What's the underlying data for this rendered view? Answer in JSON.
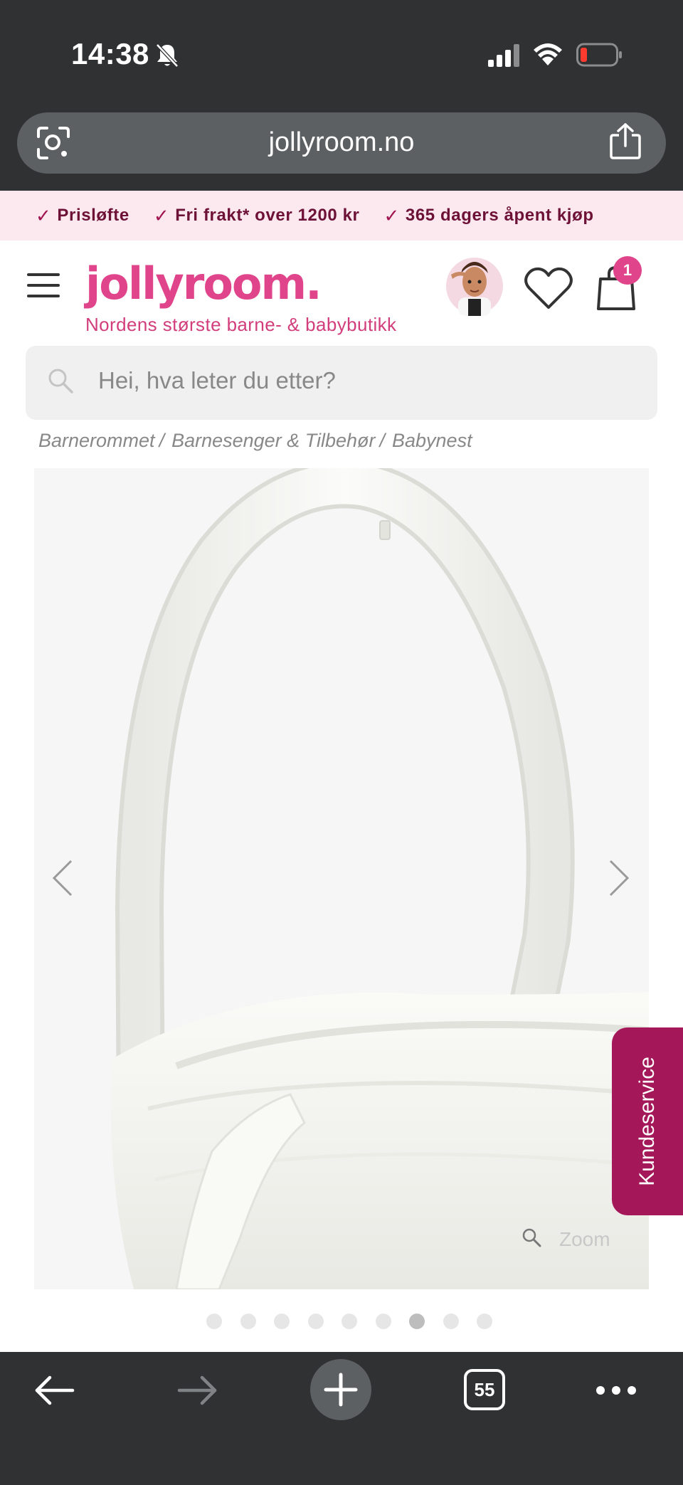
{
  "status_bar": {
    "time": "14:38"
  },
  "browser": {
    "url": "jollyroom.no",
    "tab_count": "55"
  },
  "promo": {
    "items": [
      "Prisløfte",
      "Fri frakt* over 1200 kr",
      "365 dagers åpent kjøp"
    ]
  },
  "header": {
    "logo": "jollyroom.",
    "tagline": "Nordens største barne- & babybutikk",
    "cart_count": "1"
  },
  "search": {
    "placeholder": "Hei, hva leter du etter?"
  },
  "breadcrumb": {
    "items": [
      "Barnerommet",
      "Barnesenger & Tilbehør",
      "Babynest"
    ],
    "separator": "/"
  },
  "gallery": {
    "zoom_label": "Zoom",
    "total_images": 9,
    "active_index": 6
  },
  "customer_service": {
    "label": "Kundeservice"
  },
  "colors": {
    "brand_pink": "#e0448a",
    "promo_bg": "#fbe9ef",
    "kundeservice_bg": "#a4185a",
    "chrome": "#2f3133"
  },
  "icons": [
    "bell-slash-icon",
    "signal-icon",
    "wifi-icon",
    "battery-icon",
    "lens-icon",
    "share-icon",
    "menu-icon",
    "heart-icon",
    "cart-icon",
    "search-icon",
    "chevron-left-icon",
    "chevron-right-icon",
    "zoom-icon",
    "back-arrow-icon",
    "forward-arrow-icon",
    "plus-icon",
    "more-icon"
  ]
}
